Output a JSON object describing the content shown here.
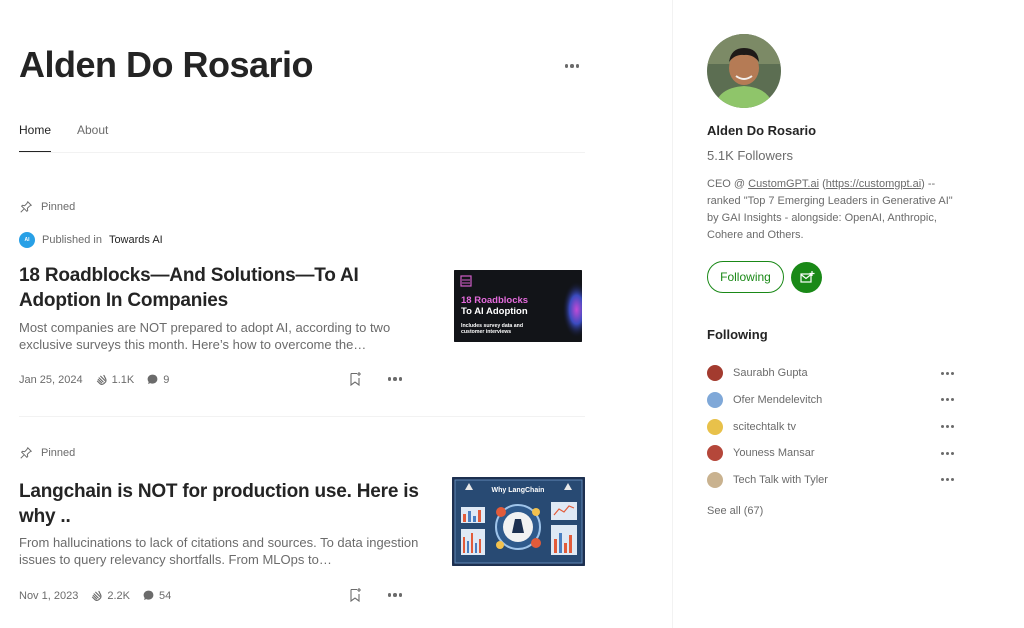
{
  "profile": {
    "name": "Alden Do Rosario"
  },
  "tabs": [
    {
      "label": "Home",
      "active": true
    },
    {
      "label": "About",
      "active": false
    }
  ],
  "articles": [
    {
      "pinned_label": "Pinned",
      "publication_prefix": "Published in",
      "publication": "Towards AI",
      "title": "18 Roadblocks—And Solutions—To AI Adoption In Companies",
      "subtitle": "Most companies are NOT prepared to adopt AI, according to two exclusive surveys this month. Here’s how to overcome the…",
      "date": "Jan 25, 2024",
      "claps": "1.1K",
      "comments": "9",
      "thumb": {
        "headline": "18 Roadblocks To AI Adoption",
        "caption": "Includes survey data and customer interviews"
      }
    },
    {
      "pinned_label": "Pinned",
      "title": "Langchain is NOT for production use. Here is why ..",
      "subtitle": "From hallucinations to lack of citations and sources. To data ingestion issues to query relevancy shortfalls. From MLOps to…",
      "date": "Nov 1, 2023",
      "claps": "2.2K",
      "comments": "54",
      "thumb": {
        "headline": "Why LangChain"
      }
    }
  ],
  "sidebar": {
    "name": "Alden Do Rosario",
    "followers": "5.1K Followers",
    "bio_prefix": "CEO @ ",
    "bio_link1": "CustomGPT.ai",
    "bio_mid": " (",
    "bio_link2": "https://customgpt.ai",
    "bio_suffix": ") -- ranked \"Top 7 Emerging Leaders in Generative AI\" by GAI Insights - alongside: OpenAI, Anthropic, Cohere and Others.",
    "following_button": "Following",
    "following_title": "Following",
    "following": [
      {
        "name": "Saurabh Gupta",
        "color": "#a33b2f"
      },
      {
        "name": "Ofer Mendelevitch",
        "color": "#7fa8d8"
      },
      {
        "name": "scitechtalk tv",
        "color": "#e8c14a"
      },
      {
        "name": "Youness Mansar",
        "color": "#b5473a"
      },
      {
        "name": "Tech Talk with Tyler",
        "color": "#c9b28f"
      }
    ],
    "see_all": "See all (67)"
  },
  "colors": {
    "accent_green": "#1a8917",
    "text_primary": "#242424",
    "text_secondary": "#6b6b6b"
  }
}
